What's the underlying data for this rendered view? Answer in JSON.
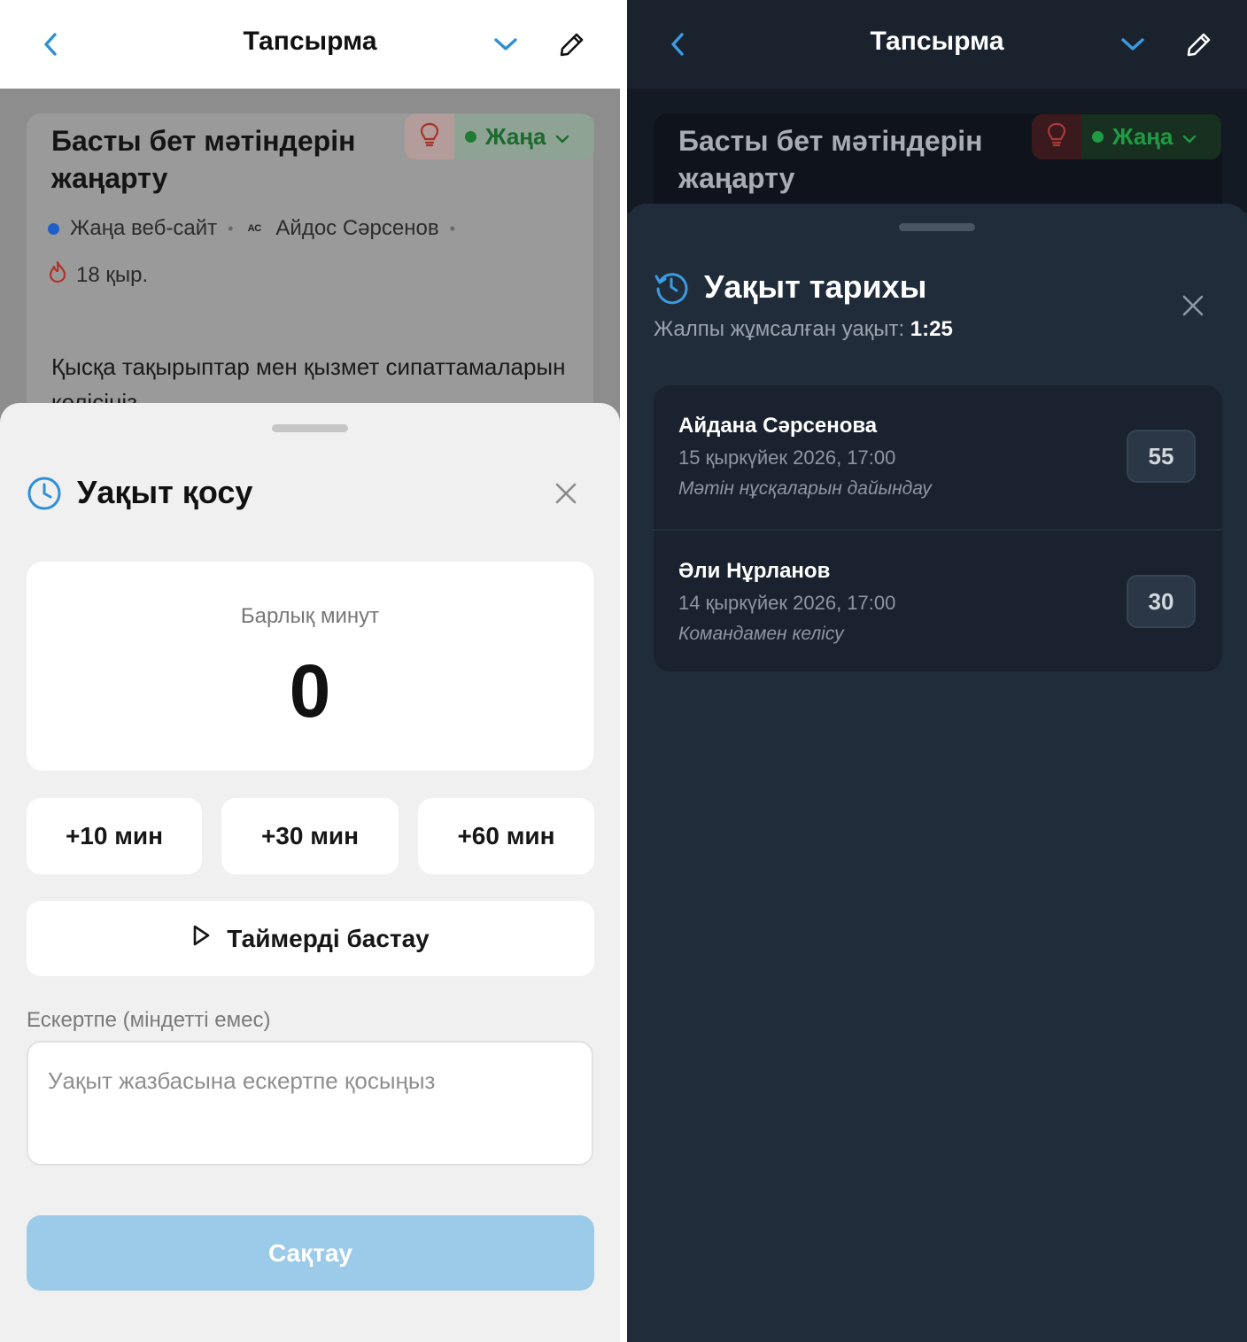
{
  "light": {
    "topbar": {
      "title": "Тапсырма"
    },
    "task": {
      "title": "Басты бет мәтіндерін жаңарту",
      "status": "Жаңа",
      "project": "Жаңа веб-сайт",
      "assignee_initials": "АС",
      "assignee": "Айдос Сәрсенов",
      "due": "18 қыр.",
      "description": "Қысқа тақырыптар мен қызмет сипаттамаларын келісіңіз."
    },
    "sheet": {
      "title": "Уақыт қосу",
      "minutes_label": "Барлық минут",
      "minutes_value": "0",
      "quick": [
        "+10 мин",
        "+30 мин",
        "+60 мин"
      ],
      "timer_button": "Таймерді бастау",
      "note_label": "Ескертпе (міндетті емес)",
      "note_placeholder": "Уақыт жазбасына ескертпе қосыңыз",
      "save_button": "Сақтау"
    }
  },
  "dark": {
    "topbar": {
      "title": "Тапсырма"
    },
    "task": {
      "title": "Басты бет мәтіндерін жаңарту",
      "status": "Жаңа"
    },
    "sheet": {
      "title": "Уақыт тарихы",
      "total_label": "Жалпы жұмсалған уақыт:",
      "total_value": "1:25",
      "entries": [
        {
          "name": "Айдана Сәрсенова",
          "date": "15 қыркүйек 2026, 17:00",
          "note": "Мәтін нұсқаларын дайындау",
          "minutes": "55"
        },
        {
          "name": "Әли Нұрланов",
          "date": "14 қыркүйек 2026, 17:00",
          "note": "Командамен келісу",
          "minutes": "30"
        }
      ]
    }
  },
  "colors": {
    "accent": "#2f8fd6",
    "status_green": "#1f8a3a",
    "save_disabled": "#9ccbea",
    "dark_bg": "#1f2937"
  },
  "icons": [
    "chevron-left-icon",
    "chevron-down-icon",
    "pencil-icon",
    "lightbulb-icon",
    "flame-icon",
    "clock-icon",
    "history-icon",
    "close-icon",
    "play-icon"
  ]
}
